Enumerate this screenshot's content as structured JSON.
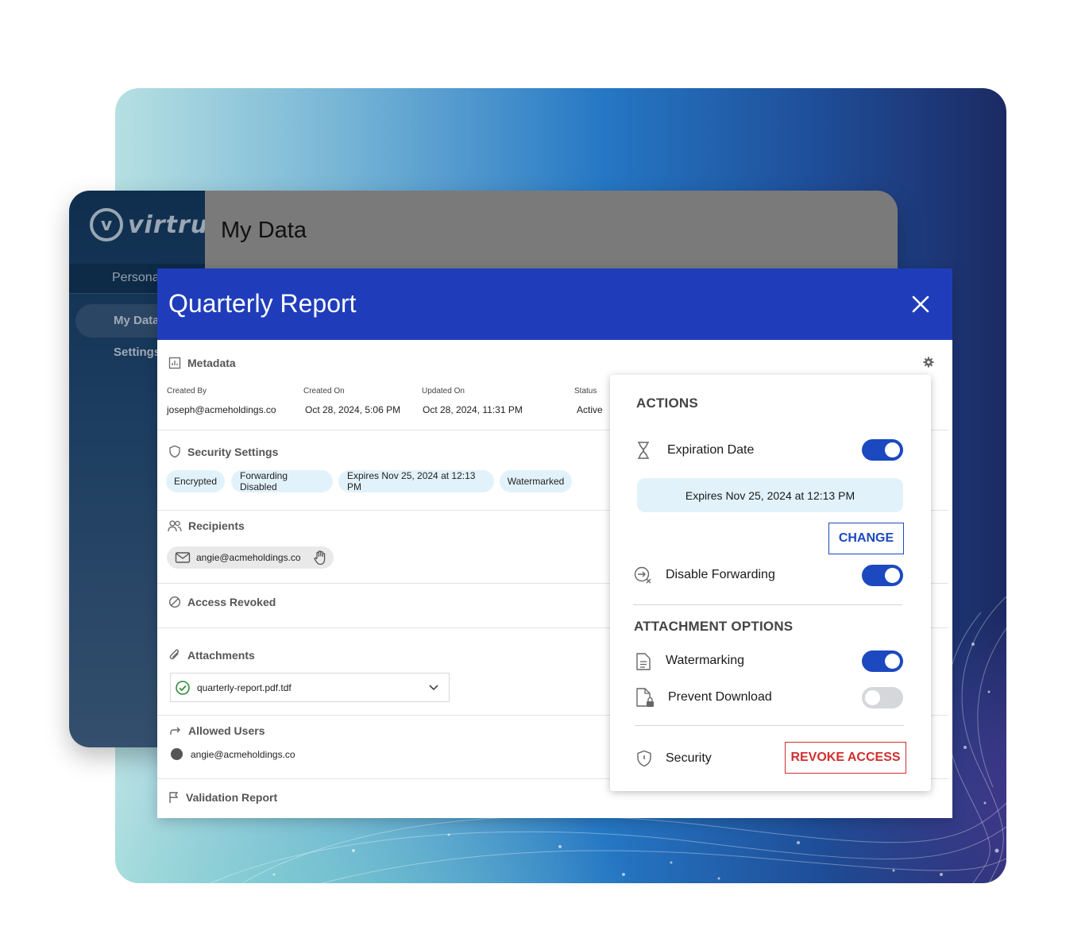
{
  "app": {
    "logo_letter": "v",
    "logo_text": "virtru",
    "personal_label": "Persona",
    "nav": [
      {
        "label": "My Data"
      },
      {
        "label": "Settings"
      }
    ],
    "page_title": "My Data"
  },
  "modal": {
    "title": "Quarterly Report",
    "metadata": {
      "heading": "Metadata",
      "fields": [
        {
          "label": "Created By",
          "value": "joseph@acmeholdings.co"
        },
        {
          "label": "Created On",
          "value": "Oct 28, 2024, 5:06 PM"
        },
        {
          "label": "Updated On",
          "value": "Oct 28, 2024, 11:31 PM"
        },
        {
          "label": "Status",
          "value": "Active"
        }
      ]
    },
    "security_settings": {
      "heading": "Security Settings",
      "chips": [
        "Encrypted",
        "Forwarding Disabled",
        "Expires Nov 25, 2024 at 12:13 PM",
        "Watermarked"
      ]
    },
    "recipients": {
      "heading": "Recipients",
      "items": [
        {
          "email": "angie@acmeholdings.co"
        }
      ]
    },
    "access_revoked": {
      "heading": "Access Revoked"
    },
    "attachments": {
      "heading": "Attachments",
      "selected": "quarterly-report.pdf.tdf"
    },
    "allowed_users": {
      "heading": "Allowed Users",
      "items": [
        {
          "email": "angie@acmeholdings.co"
        }
      ]
    },
    "validation_report": {
      "heading": "Validation Report"
    }
  },
  "actions_panel": {
    "heading": "ACTIONS",
    "expiration": {
      "label": "Expiration Date",
      "enabled": true,
      "expires_text": "Expires Nov 25, 2024 at 12:13 PM",
      "change_label": "CHANGE"
    },
    "disable_forwarding": {
      "label": "Disable Forwarding",
      "enabled": true
    },
    "attachment_heading": "ATTACHMENT OPTIONS",
    "watermarking": {
      "label": "Watermarking",
      "enabled": true
    },
    "prevent_download": {
      "label": "Prevent Download",
      "enabled": false
    },
    "security": {
      "label": "Security",
      "revoke_label": "REVOKE ACCESS"
    }
  },
  "colors": {
    "header_blue": "#1f3dbb",
    "toggle_on": "#1c49c0",
    "revoke_red": "#d03030",
    "chip_bg": "#e2f2fb"
  }
}
